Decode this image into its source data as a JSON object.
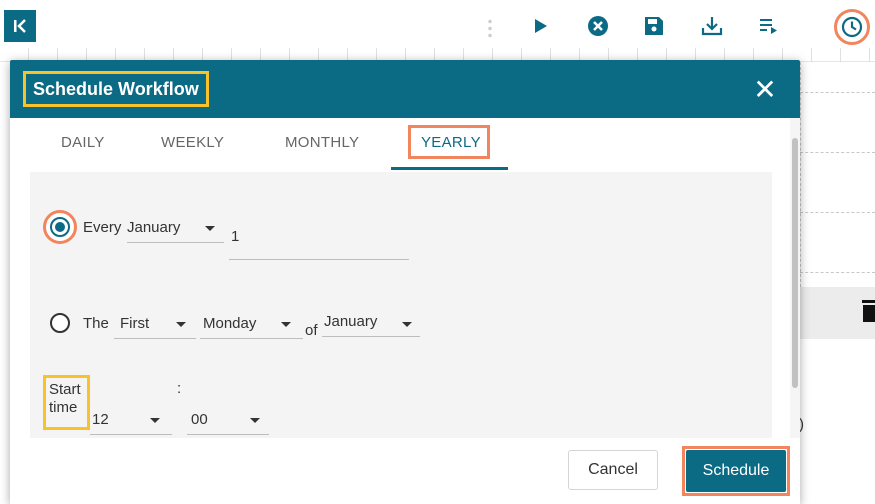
{
  "toolbar": {
    "collapse_glyph": "K",
    "icons": [
      "more-vertical-icon",
      "play-icon",
      "close-circle-icon",
      "save-icon",
      "download-icon",
      "list-play-icon",
      "clock-icon"
    ]
  },
  "modal": {
    "title": "Schedule Workflow",
    "close_glyph": "✕"
  },
  "tabs": [
    {
      "label": "DAILY",
      "active": false
    },
    {
      "label": "WEEKLY",
      "active": false
    },
    {
      "label": "MONTHLY",
      "active": false
    },
    {
      "label": "YEARLY",
      "active": true
    }
  ],
  "options": {
    "every": {
      "label": "Every",
      "month": "January",
      "day": "1",
      "selected": true
    },
    "the": {
      "label": "The",
      "ordinal": "First",
      "weekday": "Monday",
      "of_label": "of",
      "month": "January",
      "selected": false
    }
  },
  "start_time": {
    "label_line1": "Start",
    "label_line2": "time",
    "colon": ":",
    "hour": "12",
    "minute": "00"
  },
  "footer": {
    "cancel_label": "Cancel",
    "schedule_label": "Schedule"
  },
  "background": {
    "paren": ")"
  },
  "colors": {
    "primary": "#0b6a84",
    "highlight_orange": "#f2855d",
    "highlight_yellow": "#f7c22a"
  }
}
